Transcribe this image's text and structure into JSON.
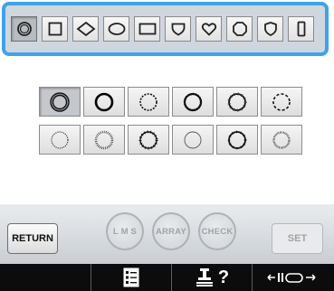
{
  "shape_tabs": [
    {
      "id": "circle-frame",
      "icon": "concentric-circle-icon",
      "selected": true
    },
    {
      "id": "square",
      "icon": "square-icon",
      "selected": false
    },
    {
      "id": "diamond",
      "icon": "diamond-icon",
      "selected": false
    },
    {
      "id": "oval",
      "icon": "oval-icon",
      "selected": false
    },
    {
      "id": "rectangle",
      "icon": "rectangle-icon",
      "selected": false
    },
    {
      "id": "shield",
      "icon": "shield-icon",
      "selected": false
    },
    {
      "id": "heart",
      "icon": "heart-icon",
      "selected": false
    },
    {
      "id": "octagon",
      "icon": "octagon-icon",
      "selected": false
    },
    {
      "id": "crest",
      "icon": "crest-icon",
      "selected": false
    },
    {
      "id": "tall-rectangle",
      "icon": "tall-rectangle-icon",
      "selected": false
    }
  ],
  "stitch_styles": [
    {
      "icon": "double-line-circle-icon",
      "selected": true
    },
    {
      "icon": "thick-line-circle-icon",
      "selected": false
    },
    {
      "icon": "dotted-circle-icon",
      "selected": false
    },
    {
      "icon": "beaded-circle-icon",
      "selected": false
    },
    {
      "icon": "notched-circle-icon",
      "selected": false
    },
    {
      "icon": "dashed-circle-icon",
      "selected": false
    },
    {
      "icon": "fine-dotted-circle-icon",
      "selected": false
    },
    {
      "icon": "zigzag-circle-icon",
      "selected": false
    },
    {
      "icon": "stitched-circle-icon",
      "selected": false
    },
    {
      "icon": "thin-circle-icon",
      "selected": false
    },
    {
      "icon": "tick-circle-icon",
      "selected": false
    },
    {
      "icon": "satin-circle-icon",
      "selected": false
    }
  ],
  "controls": {
    "return_label": "RETURN",
    "lms_label": "L M S",
    "array_label": "ARRAY",
    "check_label": "CHECK",
    "set_label": "SET"
  },
  "status_bar": {
    "help_label": "?"
  },
  "colors": {
    "frame_accent": "#3ea3e8",
    "panel": "#cfd6de",
    "status_bg": "#0c0c0c"
  }
}
